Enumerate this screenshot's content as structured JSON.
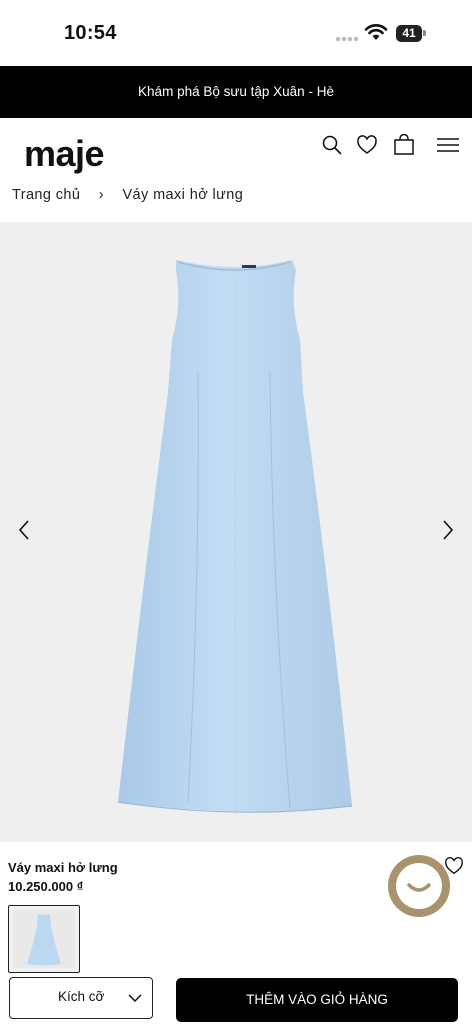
{
  "status_bar": {
    "time": "10:54",
    "battery": "41"
  },
  "promo_banner": {
    "text": "Khám phá Bộ sưu tập Xuân - Hè"
  },
  "header": {
    "logo": "maje",
    "icons": [
      "search-icon",
      "heart-icon",
      "bag-icon",
      "menu-icon"
    ]
  },
  "breadcrumb": {
    "home": "Trang chủ",
    "separator": "›",
    "current": "Váy maxi hở lưng"
  },
  "product": {
    "name": "Váy maxi hở lưng",
    "price": "10.250.000 ₫",
    "color_hex": "#bcd8f1"
  },
  "actions": {
    "size_label": "Kích cỡ",
    "add_to_cart": "THÊM VÀO GIỎ HÀNG"
  }
}
